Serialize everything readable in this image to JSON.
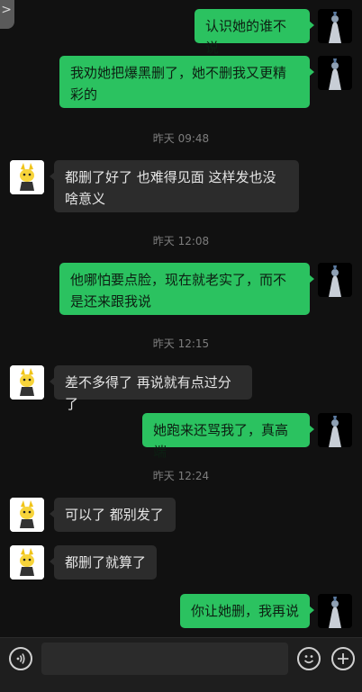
{
  "header": {
    "back_glyph": ">"
  },
  "messages": [
    {
      "side": "me",
      "text": "认识她的谁不说"
    },
    {
      "side": "me",
      "text": "我劝她把爆黑删了，她不删我又更精彩的"
    },
    {
      "time": "昨天 09:48"
    },
    {
      "side": "other",
      "text": "都删了好了 也难得见面 这样发也没啥意义"
    },
    {
      "time": "昨天 12:08"
    },
    {
      "side": "me",
      "text": "他哪怕要点脸，现在就老实了，而不是还来跟我说"
    },
    {
      "time": "昨天 12:15"
    },
    {
      "side": "other",
      "text": "差不多得了 再说就有点过分了"
    },
    {
      "side": "me",
      "text": "她跑来还骂我了，真高端"
    },
    {
      "time": "昨天 12:24"
    },
    {
      "side": "other",
      "text": "可以了 都别发了"
    },
    {
      "side": "other",
      "text": "都删了就算了"
    },
    {
      "side": "me",
      "text": "你让她删，我再说"
    }
  ],
  "input_bar": {
    "voice_icon": "voice-icon",
    "emoji_icon": "emoji-icon",
    "plus_icon": "plus-icon",
    "message_value": ""
  },
  "colors": {
    "my_bubble": "#2bc260",
    "other_bubble": "#2c2c2c",
    "background": "#111111"
  }
}
